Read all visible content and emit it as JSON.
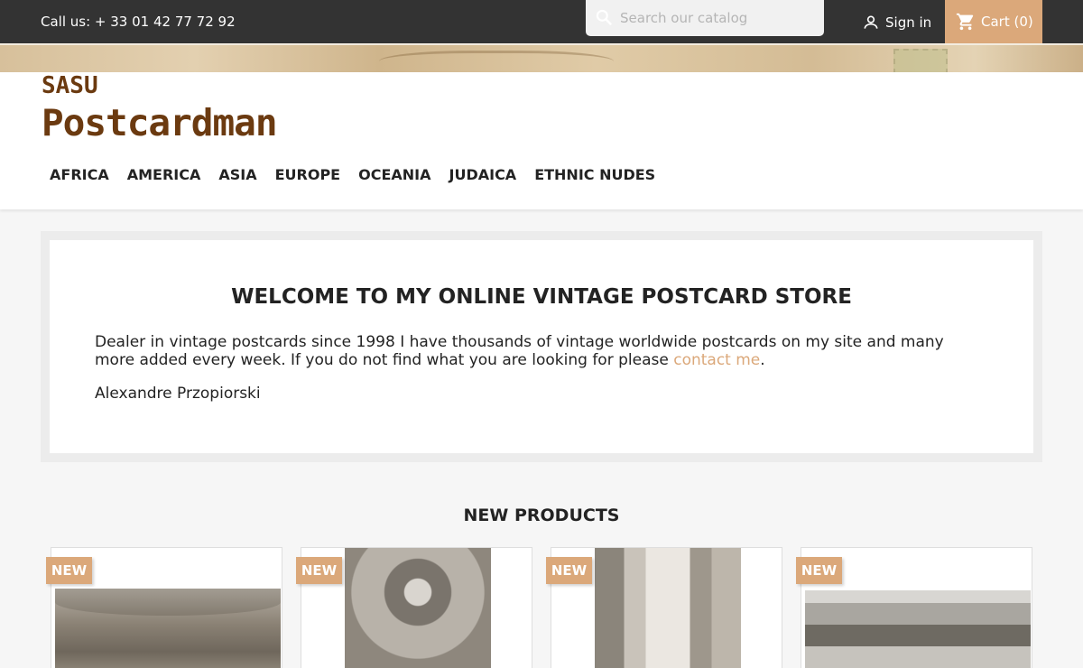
{
  "topbar": {
    "call_text": "Call us: + 33 01 42 77 72 92",
    "search_placeholder": "Search our catalog",
    "signin_label": "Sign in",
    "cart_label": "Cart (0)"
  },
  "brand": {
    "line1": "SASU",
    "line2": "Postcardman",
    "color": "#6b3a10"
  },
  "nav": {
    "items": [
      {
        "label": "AFRICA"
      },
      {
        "label": "AMERICA"
      },
      {
        "label": "ASIA"
      },
      {
        "label": "EUROPE"
      },
      {
        "label": "OCEANIA"
      },
      {
        "label": "JUDAICA"
      },
      {
        "label": "ETHNIC NUDES"
      }
    ]
  },
  "welcome": {
    "title": "WELCOME TO MY ONLINE VINTAGE POSTCARD STORE",
    "text_before_link": "Dealer in vintage postcards since 1998 I have thousands of vintage worldwide postcards on my site and many more added every week. If you do not find what you are looking for please ",
    "link_text": "contact me",
    "text_after_link": ".",
    "signature": "Alexandre Przopiorski"
  },
  "new_products": {
    "title": "NEW PRODUCTS",
    "badge_label": "NEW",
    "items": [
      {
        "badge": "NEW"
      },
      {
        "badge": "NEW"
      },
      {
        "badge": "NEW"
      },
      {
        "badge": "NEW"
      }
    ]
  },
  "colors": {
    "accent": "#dba87a",
    "topbar": "#333333",
    "text": "#232323"
  },
  "icons": {
    "search": "search-icon",
    "user": "user-icon",
    "cart": "cart-icon"
  }
}
